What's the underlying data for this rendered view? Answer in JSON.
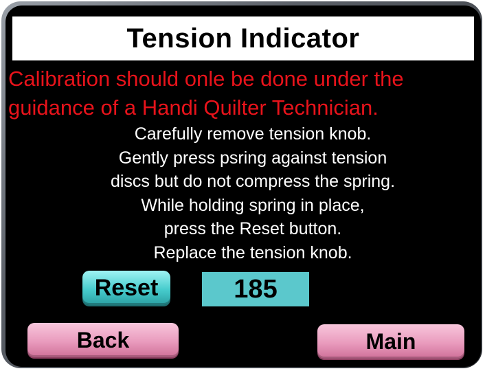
{
  "header": {
    "title": "Tension Indicator"
  },
  "warning": {
    "line1": "Calibration should onle be done under the",
    "line2": "guidance of a Handi Quilter Technician."
  },
  "instructions": [
    "Carefully remove tension knob.",
    "Gently press psring against tension",
    "discs but do not compress the spring.",
    "While holding spring in place,",
    "press the Reset button.",
    "Replace the tension knob."
  ],
  "controls": {
    "reset_label": "Reset",
    "tension_value": "185",
    "back_label": "Back",
    "main_label": "Main"
  },
  "colors": {
    "background": "#000000",
    "warning_text": "#e8131b",
    "reset_button": "#47cccd",
    "value_box": "#5bc8cc",
    "nav_button": "#e99bbd"
  }
}
